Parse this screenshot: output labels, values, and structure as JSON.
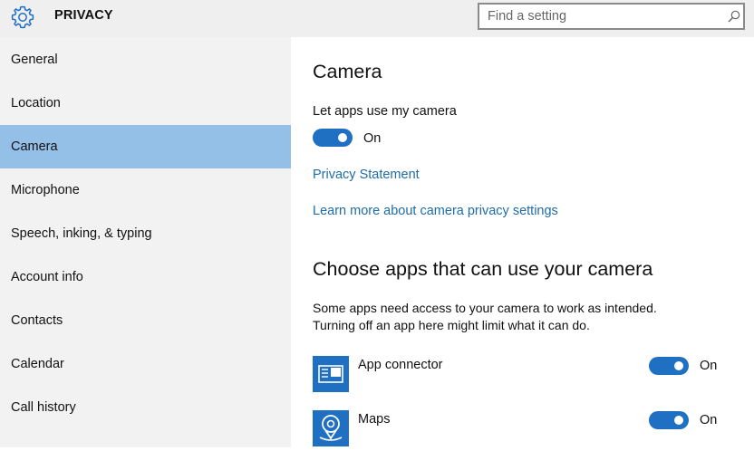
{
  "header": {
    "title": "PRIVACY",
    "search_placeholder": "Find a setting",
    "settings_icon": "gear-icon",
    "search_icon": "search-icon"
  },
  "sidebar": {
    "items": [
      {
        "label": "General",
        "selected": false
      },
      {
        "label": "Location",
        "selected": false
      },
      {
        "label": "Camera",
        "selected": true
      },
      {
        "label": "Microphone",
        "selected": false
      },
      {
        "label": "Speech, inking, & typing",
        "selected": false
      },
      {
        "label": "Account info",
        "selected": false
      },
      {
        "label": "Contacts",
        "selected": false
      },
      {
        "label": "Calendar",
        "selected": false
      },
      {
        "label": "Call history",
        "selected": false
      }
    ]
  },
  "main": {
    "title": "Camera",
    "let_apps_label": "Let apps use my camera",
    "let_apps_state": "On",
    "privacy_statement_link": "Privacy Statement",
    "learn_more_link": "Learn more about camera privacy settings",
    "choose_heading": "Choose apps that can use your camera",
    "description_line1": "Some apps need access to your camera to work as intended.",
    "description_line2": "Turning off an app here might limit what it can do.",
    "apps": [
      {
        "name": "App connector",
        "icon": "app-connector-icon",
        "state": "On"
      },
      {
        "name": "Maps",
        "icon": "maps-icon",
        "state": "On"
      }
    ]
  },
  "colors": {
    "accent": "#1f6fc2",
    "selected_nav": "#94bfe7",
    "link": "#1e6ca8",
    "sidebar_bg": "#f2f2f2",
    "header_bg": "#efefef"
  }
}
